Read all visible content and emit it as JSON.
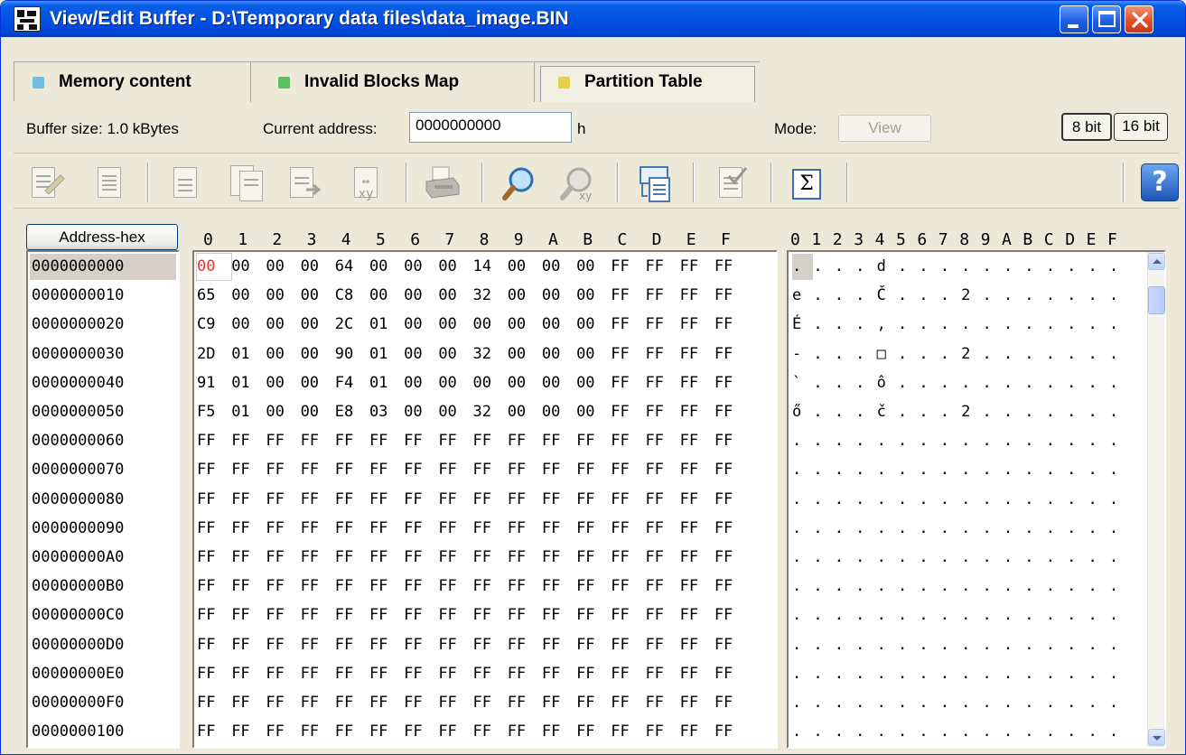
{
  "window": {
    "title": "View/Edit Buffer - D:\\Temporary data files\\data_image.BIN",
    "accent": "#0054e3"
  },
  "tabs": [
    {
      "label": "Memory content",
      "dot_color": "#6fc0e0"
    },
    {
      "label": "Invalid Blocks Map",
      "dot_color": "#58c05c"
    },
    {
      "label": "Partition Table",
      "dot_color": "#e8d14a"
    }
  ],
  "info": {
    "buffer_size": "Buffer size: 1.0 kBytes",
    "current_address_label": "Current address:",
    "current_address_value": "0000000000",
    "address_suffix": "h",
    "mode_label": "Mode:",
    "mode_button": "View",
    "bit8": "8 bit",
    "bit16": "16 bit"
  },
  "toolbar": {
    "icons": [
      "edit-icon",
      "fill-icon",
      "new-document-icon",
      "copy-document-icon",
      "export-document-icon",
      "swap-xy-icon",
      "print-icon",
      "search-icon",
      "search-xy-icon",
      "go-to-address-icon",
      "checked-document-icon",
      "checksum-icon",
      "help-icon"
    ],
    "checksum_glyph": "Σ",
    "help_glyph": "?"
  },
  "grid": {
    "address_header": "Address-hex",
    "hex_columns": [
      "0",
      "1",
      "2",
      "3",
      "4",
      "5",
      "6",
      "7",
      "8",
      "9",
      "A",
      "B",
      "C",
      "D",
      "E",
      "F"
    ],
    "ascii_header": [
      "0",
      "1",
      "2",
      "3",
      "4",
      "5",
      "6",
      "7",
      "8",
      "9",
      "A",
      "B",
      "C",
      "D",
      "E",
      "F"
    ],
    "rows": [
      {
        "addr": "0000000000",
        "hex": [
          "00",
          "00",
          "00",
          "00",
          "64",
          "00",
          "00",
          "00",
          "14",
          "00",
          "00",
          "00",
          "FF",
          "FF",
          "FF",
          "FF"
        ],
        "ascii": [
          ".",
          ".",
          ".",
          ".",
          "d",
          ".",
          ".",
          ".",
          ".",
          ".",
          ".",
          ".",
          ".",
          ".",
          ".",
          "."
        ]
      },
      {
        "addr": "0000000010",
        "hex": [
          "65",
          "00",
          "00",
          "00",
          "C8",
          "00",
          "00",
          "00",
          "32",
          "00",
          "00",
          "00",
          "FF",
          "FF",
          "FF",
          "FF"
        ],
        "ascii": [
          "e",
          ".",
          ".",
          ".",
          "Č",
          ".",
          ".",
          ".",
          "2",
          ".",
          ".",
          ".",
          ".",
          ".",
          ".",
          "."
        ]
      },
      {
        "addr": "0000000020",
        "hex": [
          "C9",
          "00",
          "00",
          "00",
          "2C",
          "01",
          "00",
          "00",
          "00",
          "00",
          "00",
          "00",
          "FF",
          "FF",
          "FF",
          "FF"
        ],
        "ascii": [
          "É",
          ".",
          ".",
          ".",
          ",",
          ".",
          ".",
          ".",
          ".",
          ".",
          ".",
          ".",
          ".",
          ".",
          ".",
          "."
        ]
      },
      {
        "addr": "0000000030",
        "hex": [
          "2D",
          "01",
          "00",
          "00",
          "90",
          "01",
          "00",
          "00",
          "32",
          "00",
          "00",
          "00",
          "FF",
          "FF",
          "FF",
          "FF"
        ],
        "ascii": [
          "-",
          ".",
          ".",
          ".",
          "□",
          ".",
          ".",
          ".",
          "2",
          ".",
          ".",
          ".",
          ".",
          ".",
          ".",
          "."
        ]
      },
      {
        "addr": "0000000040",
        "hex": [
          "91",
          "01",
          "00",
          "00",
          "F4",
          "01",
          "00",
          "00",
          "00",
          "00",
          "00",
          "00",
          "FF",
          "FF",
          "FF",
          "FF"
        ],
        "ascii": [
          "`",
          ".",
          ".",
          ".",
          "ô",
          ".",
          ".",
          ".",
          ".",
          ".",
          ".",
          ".",
          ".",
          ".",
          ".",
          "."
        ]
      },
      {
        "addr": "0000000050",
        "hex": [
          "F5",
          "01",
          "00",
          "00",
          "E8",
          "03",
          "00",
          "00",
          "32",
          "00",
          "00",
          "00",
          "FF",
          "FF",
          "FF",
          "FF"
        ],
        "ascii": [
          "ő",
          ".",
          ".",
          ".",
          "č",
          ".",
          ".",
          ".",
          "2",
          ".",
          ".",
          ".",
          ".",
          ".",
          ".",
          "."
        ]
      },
      {
        "addr": "0000000060",
        "hex": [
          "FF",
          "FF",
          "FF",
          "FF",
          "FF",
          "FF",
          "FF",
          "FF",
          "FF",
          "FF",
          "FF",
          "FF",
          "FF",
          "FF",
          "FF",
          "FF"
        ],
        "ascii": [
          ".",
          ".",
          ".",
          ".",
          ".",
          ".",
          ".",
          ".",
          ".",
          ".",
          ".",
          ".",
          ".",
          ".",
          ".",
          "."
        ]
      },
      {
        "addr": "0000000070",
        "hex": [
          "FF",
          "FF",
          "FF",
          "FF",
          "FF",
          "FF",
          "FF",
          "FF",
          "FF",
          "FF",
          "FF",
          "FF",
          "FF",
          "FF",
          "FF",
          "FF"
        ],
        "ascii": [
          ".",
          ".",
          ".",
          ".",
          ".",
          ".",
          ".",
          ".",
          ".",
          ".",
          ".",
          ".",
          ".",
          ".",
          ".",
          "."
        ]
      },
      {
        "addr": "0000000080",
        "hex": [
          "FF",
          "FF",
          "FF",
          "FF",
          "FF",
          "FF",
          "FF",
          "FF",
          "FF",
          "FF",
          "FF",
          "FF",
          "FF",
          "FF",
          "FF",
          "FF"
        ],
        "ascii": [
          ".",
          ".",
          ".",
          ".",
          ".",
          ".",
          ".",
          ".",
          ".",
          ".",
          ".",
          ".",
          ".",
          ".",
          ".",
          "."
        ]
      },
      {
        "addr": "0000000090",
        "hex": [
          "FF",
          "FF",
          "FF",
          "FF",
          "FF",
          "FF",
          "FF",
          "FF",
          "FF",
          "FF",
          "FF",
          "FF",
          "FF",
          "FF",
          "FF",
          "FF"
        ],
        "ascii": [
          ".",
          ".",
          ".",
          ".",
          ".",
          ".",
          ".",
          ".",
          ".",
          ".",
          ".",
          ".",
          ".",
          ".",
          ".",
          "."
        ]
      },
      {
        "addr": "00000000A0",
        "hex": [
          "FF",
          "FF",
          "FF",
          "FF",
          "FF",
          "FF",
          "FF",
          "FF",
          "FF",
          "FF",
          "FF",
          "FF",
          "FF",
          "FF",
          "FF",
          "FF"
        ],
        "ascii": [
          ".",
          ".",
          ".",
          ".",
          ".",
          ".",
          ".",
          ".",
          ".",
          ".",
          ".",
          ".",
          ".",
          ".",
          ".",
          "."
        ]
      },
      {
        "addr": "00000000B0",
        "hex": [
          "FF",
          "FF",
          "FF",
          "FF",
          "FF",
          "FF",
          "FF",
          "FF",
          "FF",
          "FF",
          "FF",
          "FF",
          "FF",
          "FF",
          "FF",
          "FF"
        ],
        "ascii": [
          ".",
          ".",
          ".",
          ".",
          ".",
          ".",
          ".",
          ".",
          ".",
          ".",
          ".",
          ".",
          ".",
          ".",
          ".",
          "."
        ]
      },
      {
        "addr": "00000000C0",
        "hex": [
          "FF",
          "FF",
          "FF",
          "FF",
          "FF",
          "FF",
          "FF",
          "FF",
          "FF",
          "FF",
          "FF",
          "FF",
          "FF",
          "FF",
          "FF",
          "FF"
        ],
        "ascii": [
          ".",
          ".",
          ".",
          ".",
          ".",
          ".",
          ".",
          ".",
          ".",
          ".",
          ".",
          ".",
          ".",
          ".",
          ".",
          "."
        ]
      },
      {
        "addr": "00000000D0",
        "hex": [
          "FF",
          "FF",
          "FF",
          "FF",
          "FF",
          "FF",
          "FF",
          "FF",
          "FF",
          "FF",
          "FF",
          "FF",
          "FF",
          "FF",
          "FF",
          "FF"
        ],
        "ascii": [
          ".",
          ".",
          ".",
          ".",
          ".",
          ".",
          ".",
          ".",
          ".",
          ".",
          ".",
          ".",
          ".",
          ".",
          ".",
          "."
        ]
      },
      {
        "addr": "00000000E0",
        "hex": [
          "FF",
          "FF",
          "FF",
          "FF",
          "FF",
          "FF",
          "FF",
          "FF",
          "FF",
          "FF",
          "FF",
          "FF",
          "FF",
          "FF",
          "FF",
          "FF"
        ],
        "ascii": [
          ".",
          ".",
          ".",
          ".",
          ".",
          ".",
          ".",
          ".",
          ".",
          ".",
          ".",
          ".",
          ".",
          ".",
          ".",
          "."
        ]
      },
      {
        "addr": "00000000F0",
        "hex": [
          "FF",
          "FF",
          "FF",
          "FF",
          "FF",
          "FF",
          "FF",
          "FF",
          "FF",
          "FF",
          "FF",
          "FF",
          "FF",
          "FF",
          "FF",
          "FF"
        ],
        "ascii": [
          ".",
          ".",
          ".",
          ".",
          ".",
          ".",
          ".",
          ".",
          ".",
          ".",
          ".",
          ".",
          ".",
          ".",
          ".",
          "."
        ]
      },
      {
        "addr": "0000000100",
        "hex": [
          "FF",
          "FF",
          "FF",
          "FF",
          "FF",
          "FF",
          "FF",
          "FF",
          "FF",
          "FF",
          "FF",
          "FF",
          "FF",
          "FF",
          "FF",
          "FF"
        ],
        "ascii": [
          ".",
          ".",
          ".",
          ".",
          ".",
          ".",
          ".",
          ".",
          ".",
          ".",
          ".",
          ".",
          ".",
          ".",
          ".",
          "."
        ]
      }
    ]
  }
}
